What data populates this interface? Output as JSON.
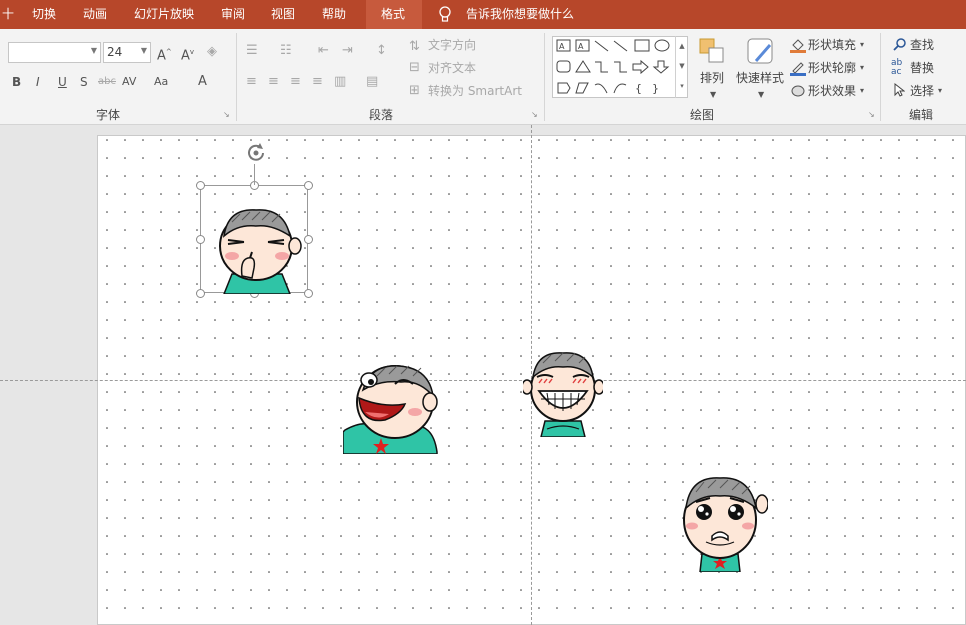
{
  "menu": {
    "cut_tab": "十",
    "items": [
      "切换",
      "动画",
      "幻灯片放映",
      "审阅",
      "视图",
      "帮助",
      "格式"
    ],
    "active": "格式",
    "tell_me": "告诉我你想要做什么"
  },
  "font_group": {
    "font_name": "",
    "font_size": "24",
    "label": "字体",
    "buttons": [
      "B",
      "I",
      "U",
      "S",
      "abc",
      "AV",
      "Aa",
      "A"
    ]
  },
  "paragraph_group": {
    "text_direction": "文字方向",
    "align_text": "对齐文本",
    "convert_smartart": "转换为 SmartArt",
    "label": "段落"
  },
  "drawing_group": {
    "arrange": "排列",
    "quick_styles": "快速样式",
    "shape_fill": "形状填充",
    "shape_outline": "形状轮廓",
    "shape_effects": "形状效果",
    "label": "绘图"
  },
  "editing_group": {
    "find": "查找",
    "replace": "替换",
    "select": "选择",
    "label": "编辑"
  },
  "colors": {
    "menubar": "#b7472a",
    "ribbon": "#f3f3f3",
    "fill_accent": "#e07b39",
    "outline_accent": "#3a6fc4",
    "character_shirt": "#2fc4a6",
    "blush": "#f4a6a6"
  }
}
